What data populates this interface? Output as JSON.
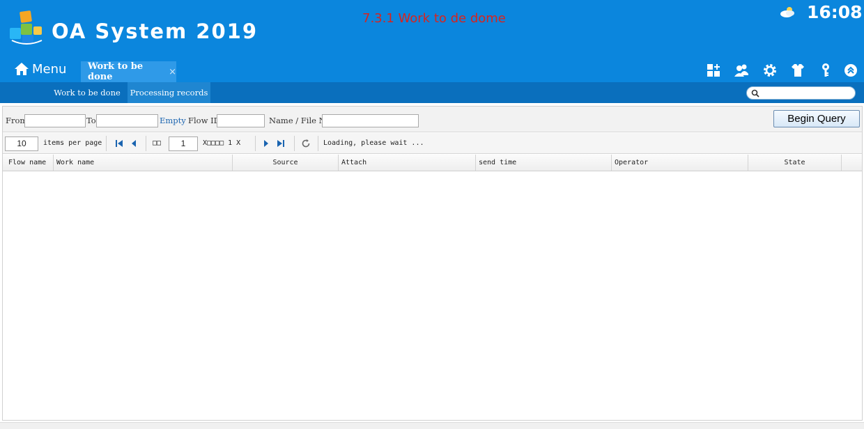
{
  "header": {
    "app_title": "OA System 2019",
    "annotation": "7.3.1 Work to de dome",
    "clock": "16:08",
    "menu_label": "Menu",
    "active_tab": {
      "label": "Work to be done",
      "close": "×"
    },
    "toolbar_icons": [
      "apps-add-icon",
      "users-icon",
      "settings-gear-icon",
      "shirt-skin-icon",
      "key-icon",
      "collapse-up-icon"
    ]
  },
  "subnav": {
    "items": [
      "Work to be done",
      "Processing records"
    ],
    "selected": "Processing records",
    "search_placeholder": ""
  },
  "query": {
    "from_label": "From",
    "to_label": "To",
    "empty_link": "Empty",
    "flow_id_label": "Flow ID",
    "name_file_label": "Name / File No.",
    "from_value": "",
    "to_value": "",
    "flow_id_value": "",
    "name_file_value": "",
    "button": "Begin Query"
  },
  "pager": {
    "page_size": "10",
    "items_per_page": "items per page",
    "page_prefix": "□□",
    "page_number": "1",
    "page_suffix": "X□□□□ 1 X",
    "status": "Loading, please wait ..."
  },
  "grid": {
    "columns": [
      "Flow name",
      "Work name",
      "Source",
      "Attach",
      "send time",
      "Operator",
      "State"
    ],
    "rows": []
  },
  "colors": {
    "header_bg": "#0b86dd",
    "subnav_bg": "#0a6fbd",
    "annotation": "#d8231e"
  }
}
